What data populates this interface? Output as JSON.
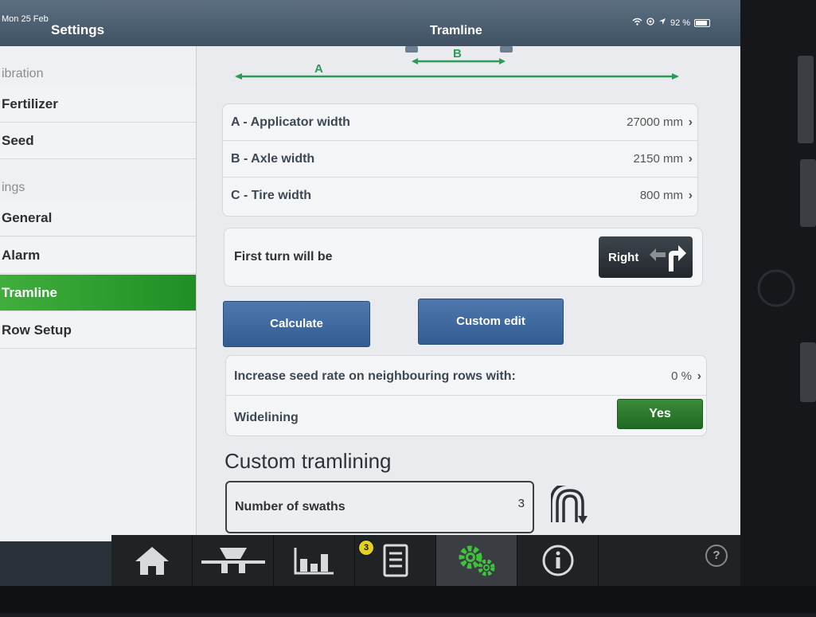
{
  "status": {
    "date": "Mon 25 Feb",
    "battery": "92 %"
  },
  "nav": {
    "left_title": "Settings",
    "main_title": "Tramline"
  },
  "sidebar": {
    "sections": [
      {
        "label": "ibration"
      },
      {
        "label": "ings"
      }
    ],
    "items": [
      {
        "label": "Fertilizer"
      },
      {
        "label": "Seed"
      },
      {
        "label": "General"
      },
      {
        "label": "Alarm"
      },
      {
        "label": "Tramline"
      },
      {
        "label": "Row Setup"
      }
    ],
    "active_index": 4
  },
  "diagram": {
    "label_a": "A",
    "label_b": "B"
  },
  "widths": [
    {
      "label": "A - Applicator width",
      "value": "27000 mm"
    },
    {
      "label": "B - Axle width",
      "value": "2150 mm"
    },
    {
      "label": "C - Tire width",
      "value": "800 mm"
    }
  ],
  "first_turn": {
    "label": "First turn will be",
    "button": "Right"
  },
  "buttons": {
    "calculate": "Calculate",
    "custom_edit": "Custom edit"
  },
  "seed_rate": {
    "label": "Increase seed rate on neighbouring rows with:",
    "value": "0 %"
  },
  "widelining": {
    "label": "Widelining",
    "value": "Yes"
  },
  "custom_section": {
    "heading": "Custom tramlining"
  },
  "swaths": {
    "label": "Number of swaths",
    "value": "3"
  },
  "toolbar": {
    "items": [
      {
        "icon": "home-icon"
      },
      {
        "icon": "spreader-icon"
      },
      {
        "icon": "bar-chart-icon"
      },
      {
        "icon": "document-icon",
        "badge": "3"
      },
      {
        "icon": "settings-gears-icon"
      },
      {
        "icon": "info-icon"
      }
    ],
    "active_index": 4,
    "help": "?"
  },
  "colors": {
    "accent_green": "#2c9e2e",
    "button_blue": "#3f6aa1",
    "toggle_green": "#2a7a2c"
  }
}
